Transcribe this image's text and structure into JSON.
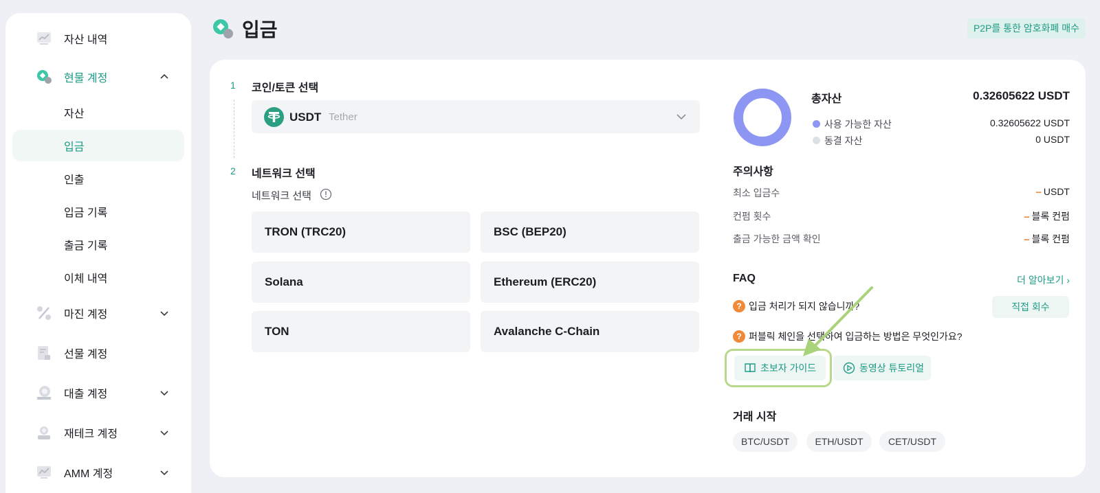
{
  "sidebar": {
    "items": [
      {
        "label": "자산 내역",
        "icon": "chart-icon"
      },
      {
        "label": "현물 계정",
        "icon": "spot-account-icon",
        "expanded": true
      },
      {
        "label": "자산"
      },
      {
        "label": "입금",
        "active": true
      },
      {
        "label": "인출"
      },
      {
        "label": "입금 기록"
      },
      {
        "label": "출금 기록"
      },
      {
        "label": "이체 내역"
      },
      {
        "label": "마진 계정",
        "icon": "percent-icon"
      },
      {
        "label": "선물 계정",
        "icon": "futures-icon"
      },
      {
        "label": "대출 계정",
        "icon": "loan-icon"
      },
      {
        "label": "재테크 계정",
        "icon": "finance-icon"
      },
      {
        "label": "AMM 계정",
        "icon": "amm-icon"
      }
    ]
  },
  "header": {
    "title": "입금",
    "p2p_button": "P2P를 통한 암호화폐 매수"
  },
  "steps": {
    "step1": {
      "num": "1",
      "title": "코인/토큰 선택"
    },
    "step2": {
      "num": "2",
      "title": "네트워크 선택"
    }
  },
  "coin": {
    "symbol": "USDT",
    "name": "Tether"
  },
  "network": {
    "label": "네트워크 선택",
    "options": [
      "TRON (TRC20)",
      "BSC (BEP20)",
      "Solana",
      "Ethereum (ERC20)",
      "TON",
      "Avalanche C-Chain"
    ]
  },
  "assets": {
    "total_label": "총자산",
    "total_value": "0.32605622 USDT",
    "available_label": "사용 가능한 자산",
    "available_value": "0.32605622 USDT",
    "frozen_label": "동결 자산",
    "frozen_value": "0 USDT",
    "available_color": "#8d97f3",
    "frozen_color": "#dde0e6"
  },
  "notes": {
    "title": "주의사항",
    "rows": [
      {
        "label": "최소 입금수",
        "dash": "--",
        "unit": "USDT"
      },
      {
        "label": "컨펌 횟수",
        "dash": "--",
        "unit": "블록 컨펌"
      },
      {
        "label": "출금 가능한 금액 확인",
        "dash": "--",
        "unit": "블록 컨펌"
      }
    ]
  },
  "faq": {
    "title": "FAQ",
    "more": "더 알아보기 ›",
    "q1": "입금 처리가 되지 않습니까?",
    "q2": "퍼블릭 체인을 선택하여 입금하는 방법은 무엇인가요?",
    "recover": "직접 회수",
    "guide": "초보자 가이드",
    "video": "동영상 튜토리얼"
  },
  "trade": {
    "title": "거래 시작",
    "pairs": [
      "BTC/USDT",
      "ETH/USDT",
      "CET/USDT"
    ]
  },
  "colors": {
    "accent": "#1c9b85",
    "highlight": "#b8d98b"
  }
}
